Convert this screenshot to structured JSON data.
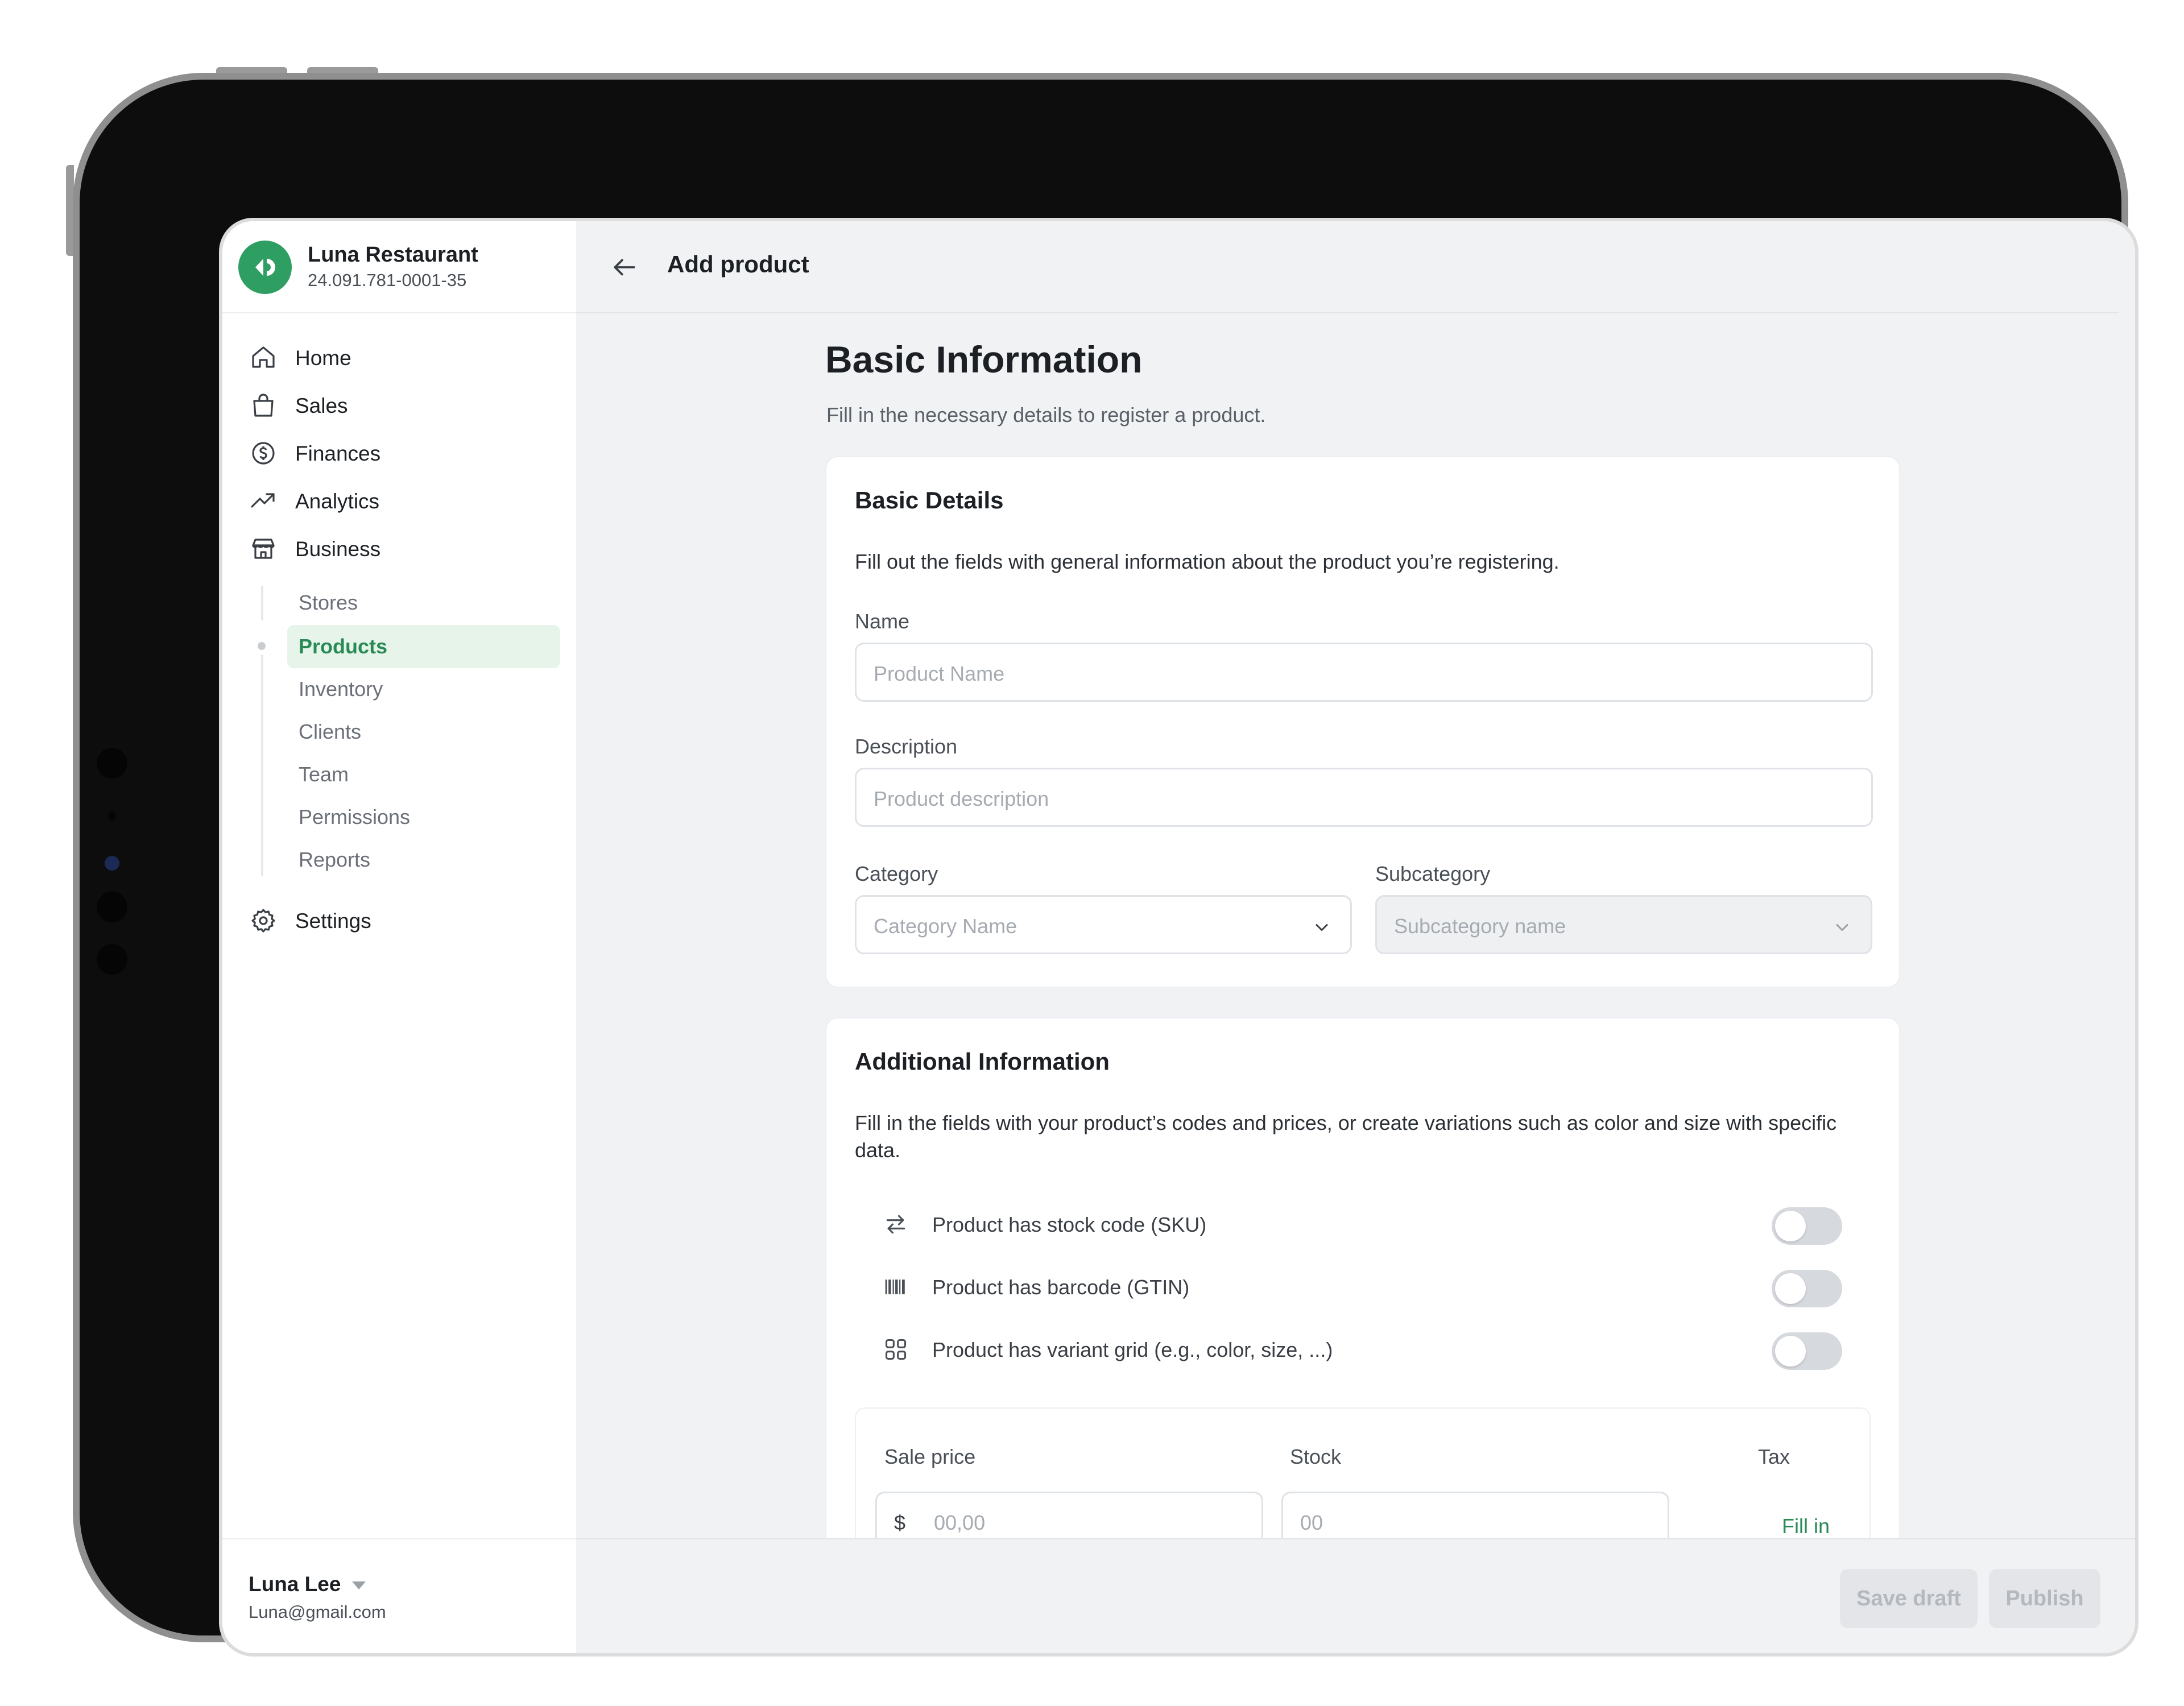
{
  "brand": {
    "name": "Luna Restaurant",
    "id": "24.091.781-0001-35"
  },
  "nav": {
    "items": [
      {
        "label": "Home",
        "icon": "home-icon"
      },
      {
        "label": "Sales",
        "icon": "shopping-bag-icon"
      },
      {
        "label": "Finances",
        "icon": "dollar-icon"
      },
      {
        "label": "Analytics",
        "icon": "trend-up-icon"
      },
      {
        "label": "Business",
        "icon": "store-icon"
      }
    ],
    "sub_items": [
      "Stores",
      "Products",
      "Inventory",
      "Clients",
      "Team",
      "Permissions",
      "Reports"
    ],
    "active_sub": "Products",
    "settings": {
      "label": "Settings",
      "icon": "gear-icon"
    }
  },
  "user": {
    "name": "Luna Lee",
    "email": "Luna@gmail.com"
  },
  "header": {
    "title": "Add product"
  },
  "main": {
    "title": "Basic Information",
    "subtitle": "Fill in the necessary details to register a product."
  },
  "basic_details": {
    "title": "Basic Details",
    "description": "Fill out the fields with general information about the product you’re registering.",
    "name_label": "Name",
    "name_placeholder": "Product Name",
    "description_label": "Description",
    "description_placeholder": "Product description",
    "category_label": "Category",
    "category_placeholder": "Category Name",
    "subcategory_label": "Subcategory",
    "subcategory_placeholder": "Subcategory name"
  },
  "additional": {
    "title": "Additional Information",
    "description": "Fill in the fields with your product’s codes and prices, or create variations such as color and size with specific data.",
    "toggles": [
      {
        "label": "Product has stock code (SKU)",
        "icon": "swap-arrows-icon",
        "on": false
      },
      {
        "label": "Product has barcode (GTIN)",
        "icon": "barcode-icon",
        "on": false
      },
      {
        "label": "Product has variant grid (e.g., color, size, ...)",
        "icon": "grid-icon",
        "on": false
      }
    ],
    "price_label": "Sale price",
    "stock_label": "Stock",
    "tax_label": "Tax",
    "currency": "$",
    "price_placeholder": "00,00",
    "stock_placeholder": "00",
    "tax_link": "Fill in"
  },
  "footer": {
    "save_draft": "Save draft",
    "publish": "Publish"
  },
  "colors": {
    "accent": "#2f9e63",
    "active_bg": "#e6f4ea",
    "link": "#2a8a55"
  }
}
